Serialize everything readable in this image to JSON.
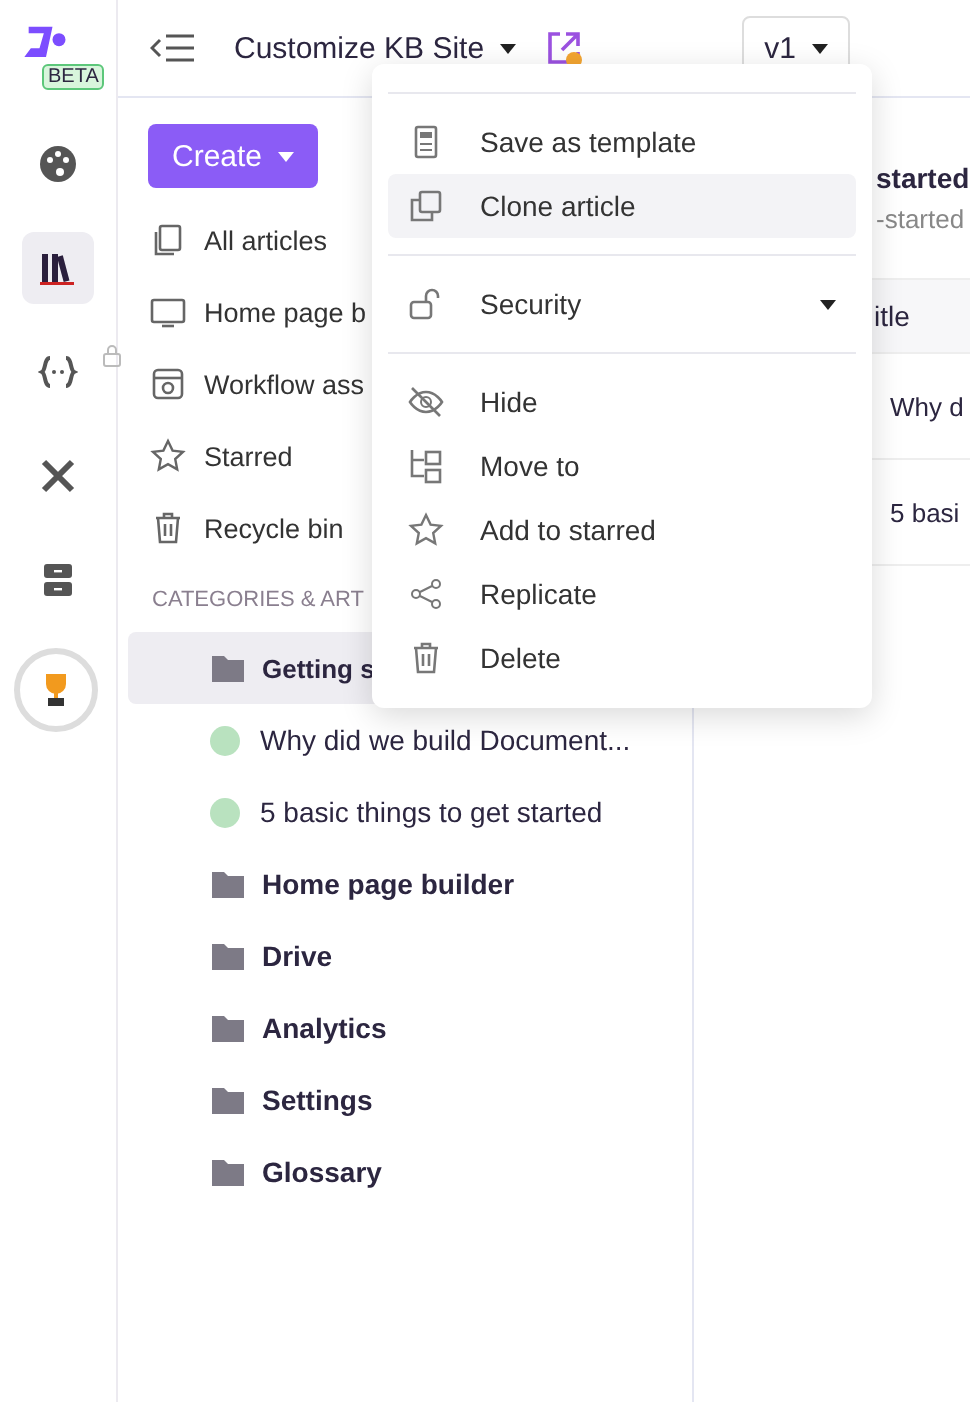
{
  "rail": {
    "badge": "BETA",
    "items": [
      {
        "selected": false
      },
      {
        "selected": true
      },
      {
        "selected": false
      },
      {
        "selected": false
      },
      {
        "selected": false
      },
      {
        "selected": false
      }
    ]
  },
  "header": {
    "title": "Customize KB Site",
    "version": "v1"
  },
  "sidebar": {
    "create": "Create",
    "items": [
      {
        "label": "All articles"
      },
      {
        "label": "Home page b"
      },
      {
        "label": "Workflow ass"
      },
      {
        "label": "Starred"
      },
      {
        "label": "Recycle bin"
      }
    ],
    "section": "CATEGORIES & ART",
    "tree": [
      {
        "kind": "folder",
        "label": "Getting s",
        "selected": true
      },
      {
        "kind": "article",
        "label": "Why did we build Document...",
        "color": "#b9e2bf",
        "selected": false
      },
      {
        "kind": "article",
        "label": "5 basic things to get started",
        "color": "#b9e2bf",
        "selected": false
      },
      {
        "kind": "folder",
        "label": "Home page builder",
        "selected": false
      },
      {
        "kind": "folder",
        "label": "Drive",
        "selected": false
      },
      {
        "kind": "folder",
        "label": "Analytics",
        "selected": false
      },
      {
        "kind": "folder",
        "label": "Settings",
        "selected": false
      },
      {
        "kind": "folder",
        "label": "Glossary",
        "selected": false
      }
    ]
  },
  "panel": {
    "title": "started",
    "subtitle": "-started",
    "column_1": "itle",
    "rows": [
      "Why d",
      "5 basi"
    ]
  },
  "menu": {
    "groups": [
      [
        {
          "label": "Save as template",
          "selected": false,
          "submenu": false
        },
        {
          "label": "Clone article",
          "selected": true,
          "submenu": false
        }
      ],
      [
        {
          "label": "Security",
          "selected": false,
          "submenu": true
        }
      ],
      [
        {
          "label": "Hide",
          "selected": false,
          "submenu": false
        },
        {
          "label": "Move to",
          "selected": false,
          "submenu": false
        },
        {
          "label": "Add to starred",
          "selected": false,
          "submenu": false
        },
        {
          "label": "Replicate",
          "selected": false,
          "submenu": false
        },
        {
          "label": "Delete",
          "selected": false,
          "submenu": false
        }
      ]
    ]
  }
}
